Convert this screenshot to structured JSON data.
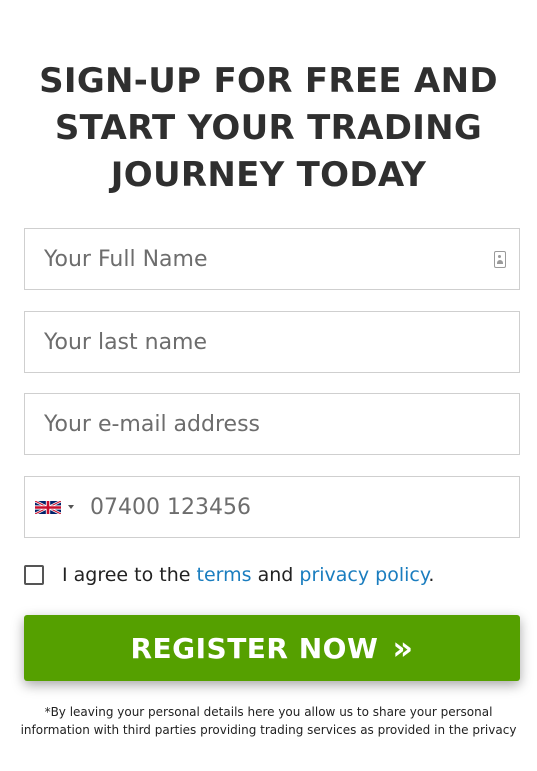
{
  "heading": {
    "line1": "SIGN-UP FOR FREE AND",
    "line2": "START YOUR TRADING",
    "line3": "JOURNEY TODAY"
  },
  "form": {
    "full_name": {
      "placeholder": "Your Full Name",
      "value": ""
    },
    "last_name": {
      "placeholder": "Your last name",
      "value": ""
    },
    "email": {
      "placeholder": "Your e-mail address",
      "value": ""
    },
    "phone": {
      "placeholder": "07400 123456",
      "value": "",
      "country_flag": "uk-flag-icon"
    }
  },
  "consent": {
    "prefix": "I agree to the",
    "terms_link": "terms",
    "and": "and",
    "privacy_link": "privacy policy",
    "suffix": ".",
    "checked": false
  },
  "register_button": {
    "label": "REGISTER NOW",
    "arrows": "»",
    "color": "#55a000"
  },
  "disclaimer": {
    "line1": "*By leaving your personal details here you allow us to share your personal",
    "line2": "information with third parties providing trading services as provided in the privacy"
  },
  "colors": {
    "heading": "#2f2f2f",
    "link": "#1a7dbf",
    "border": "#cfcfcf"
  }
}
